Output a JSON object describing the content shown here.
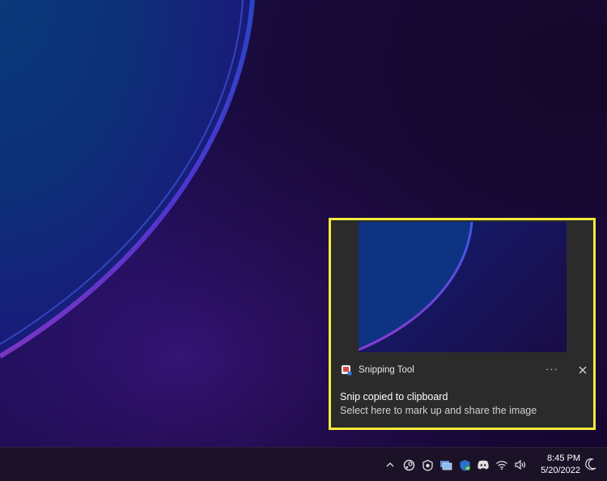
{
  "notification": {
    "app_name": "Snipping Tool",
    "more_label": "···",
    "title": "Snip copied to clipboard",
    "body": "Select here to mark up and share the image",
    "highlight_color": "#f3ea3a"
  },
  "tray": {
    "icons": [
      "chevron-up-icon",
      "steam-icon",
      "shield-icon",
      "monitor-icon",
      "security-shield-icon",
      "discord-icon",
      "wifi-icon",
      "volume-icon"
    ],
    "time": "8:45 PM",
    "date": "5/20/2022",
    "focus_icon": "moon-icon"
  }
}
